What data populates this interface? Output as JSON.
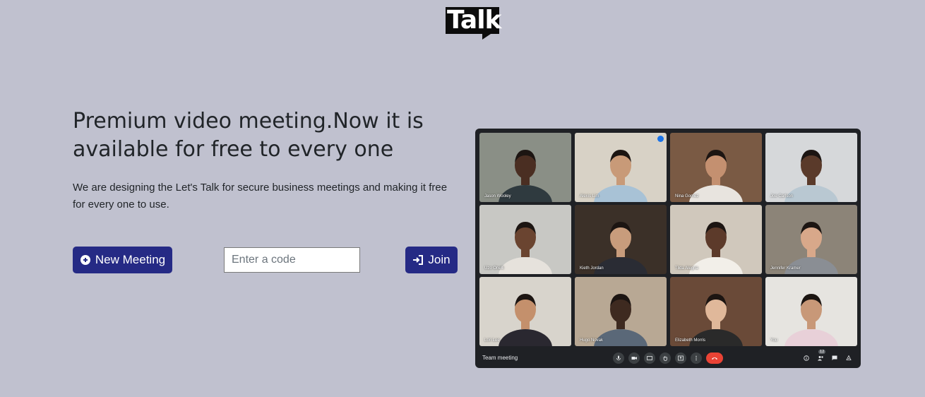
{
  "logo": {
    "text": "Talk"
  },
  "hero": {
    "headline": "Premium video meeting.Now it is available for free to every one",
    "subtext": "We are designing the Let's Talk for secure business meetings and making it free for every one to use."
  },
  "actions": {
    "new_meeting_label": "New Meeting",
    "code_placeholder": "Enter a code",
    "join_label": "Join"
  },
  "meeting_preview": {
    "title": "Team meeting",
    "participant_count": "12",
    "tiles": [
      {
        "name": "Jason Wooley",
        "bg": "#8a8f86",
        "skin": "#4a2e22",
        "shirt": "#2f3a3f"
      },
      {
        "name": "Alexis Lim",
        "bg": "#d8d2c6",
        "skin": "#c89a78",
        "shirt": "#a8c2d6",
        "badge": true
      },
      {
        "name": "Nina Gomez",
        "bg": "#7a5a44",
        "skin": "#c49070",
        "shirt": "#e8e4df"
      },
      {
        "name": "Joe Carlson",
        "bg": "#d6d8da",
        "skin": "#5a3a2a",
        "shirt": "#b9c8d2"
      },
      {
        "name": "Uzo Onelli",
        "bg": "#c8c8c4",
        "skin": "#6a4430",
        "shirt": "#e6e2dc"
      },
      {
        "name": "Kieth Jordan",
        "bg": "#3b3028",
        "skin": "#c89c7c",
        "shirt": "#2a2c34"
      },
      {
        "name": "Tilda Alegria",
        "bg": "#d0c8bc",
        "skin": "#5c3a2a",
        "shirt": "#f2efe9"
      },
      {
        "name": "Jennifer Kramer",
        "bg": "#8c8478",
        "skin": "#d8a88a",
        "shirt": "#8a8e94"
      },
      {
        "name": "Lori Lee",
        "bg": "#d8d4cc",
        "skin": "#c4906c",
        "shirt": "#2a2830"
      },
      {
        "name": "Hugo Novak",
        "bg": "#b8a894",
        "skin": "#3e2a20",
        "shirt": "#5a6878"
      },
      {
        "name": "Elizabeth Morris",
        "bg": "#6a4a38",
        "skin": "#e0b89a",
        "shirt": "#2a2a2a"
      },
      {
        "name": "You",
        "bg": "#e6e4e0",
        "skin": "#c89878",
        "shirt": "#e8d0d8"
      }
    ]
  }
}
